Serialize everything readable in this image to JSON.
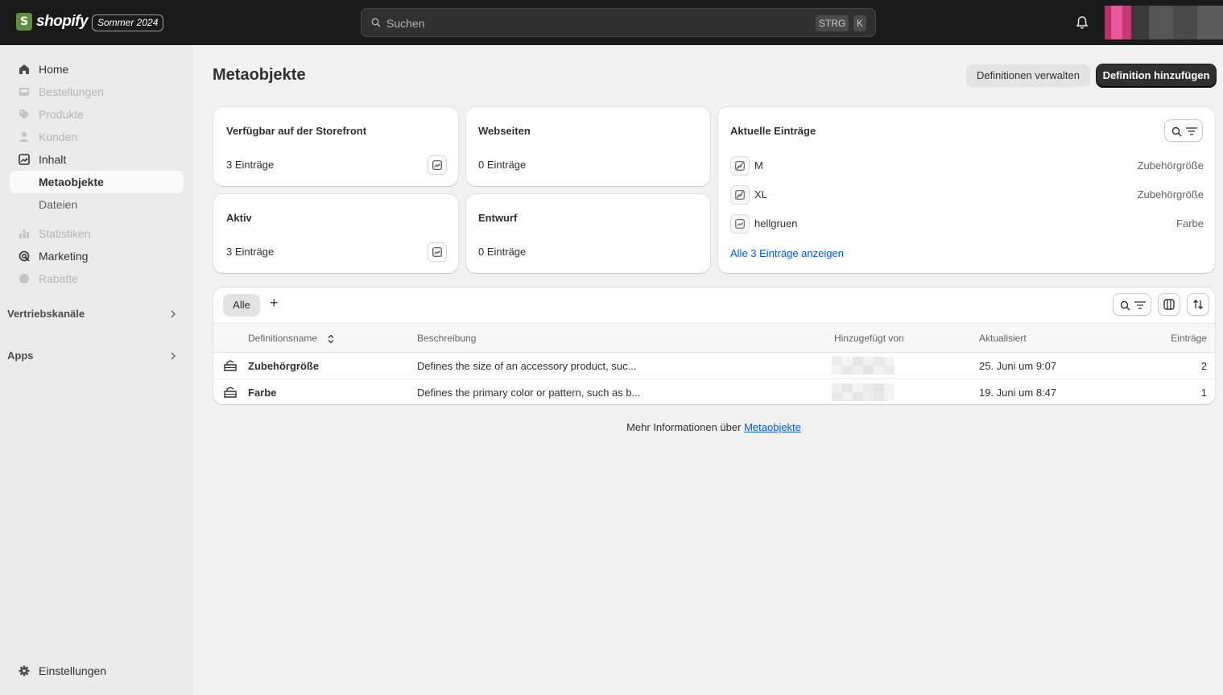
{
  "topbar": {
    "logo_text": "shopify",
    "edition": "Sommer 2024",
    "search_placeholder": "Suchen",
    "kbd_1": "STRG",
    "kbd_2": "K"
  },
  "sidebar": {
    "items": [
      {
        "label": "Home",
        "icon": "home-icon",
        "state": "normal"
      },
      {
        "label": "Bestellungen",
        "icon": "inbox-icon",
        "state": "disabled"
      },
      {
        "label": "Produkte",
        "icon": "tag-icon",
        "state": "disabled"
      },
      {
        "label": "Kunden",
        "icon": "person-icon",
        "state": "disabled"
      },
      {
        "label": "Inhalt",
        "icon": "image-icon",
        "state": "normal"
      },
      {
        "label": "Metaobjekte",
        "icon": "",
        "state": "active"
      },
      {
        "label": "Dateien",
        "icon": "",
        "state": "sub"
      },
      {
        "label": "Statistiken",
        "icon": "chart-icon",
        "state": "disabled"
      },
      {
        "label": "Marketing",
        "icon": "target-icon",
        "state": "normal"
      },
      {
        "label": "Rabatte",
        "icon": "discount-icon",
        "state": "disabled"
      }
    ],
    "sections": [
      {
        "label": "Vertriebskanäle"
      },
      {
        "label": "Apps"
      }
    ],
    "settings_label": "Einstellungen"
  },
  "page": {
    "title": "Metaobjekte",
    "manage_button": "Definitionen verwalten",
    "add_button": "Definition hinzufügen"
  },
  "summary_cards": [
    {
      "title": "Verfügbar auf der Storefront",
      "count": "3 Einträge"
    },
    {
      "title": "Webseiten",
      "count": "0 Einträge"
    },
    {
      "title": "Aktiv",
      "count": "3 Einträge"
    },
    {
      "title": "Entwurf",
      "count": "0 Einträge"
    }
  ],
  "recent": {
    "title": "Aktuelle Einträge",
    "entries": [
      {
        "name": "M",
        "type": "Zubehörgröße",
        "icon": "image-off-icon"
      },
      {
        "name": "XL",
        "type": "Zubehörgröße",
        "icon": "image-off-icon"
      },
      {
        "name": "hellgruen",
        "type": "Farbe",
        "icon": "image-icon"
      }
    ],
    "show_all": "Alle 3 Einträge anzeigen"
  },
  "table": {
    "tab_all": "Alle",
    "add_tab": "+",
    "columns": {
      "name": "Definitionsname",
      "description": "Beschreibung",
      "added_by": "Hinzugefügt von",
      "updated": "Aktualisiert",
      "entries": "Einträge"
    },
    "rows": [
      {
        "name": "Zubehörgröße",
        "description": "Defines the size of an accessory product, suc...",
        "updated": "25. Juni um 9:07",
        "entries": "2"
      },
      {
        "name": "Farbe",
        "description": "Defines the primary color or pattern, such as b...",
        "updated": "19. Juni um 8:47",
        "entries": "1"
      }
    ]
  },
  "footer": {
    "text": "Mehr Informationen über",
    "link": "Metaobjekte"
  },
  "colors": {
    "topbar": "#1a1a1a",
    "sidebar": "#ebebeb",
    "background": "#f1f1f1",
    "primary_button": "#303030",
    "link": "#005bd3"
  }
}
